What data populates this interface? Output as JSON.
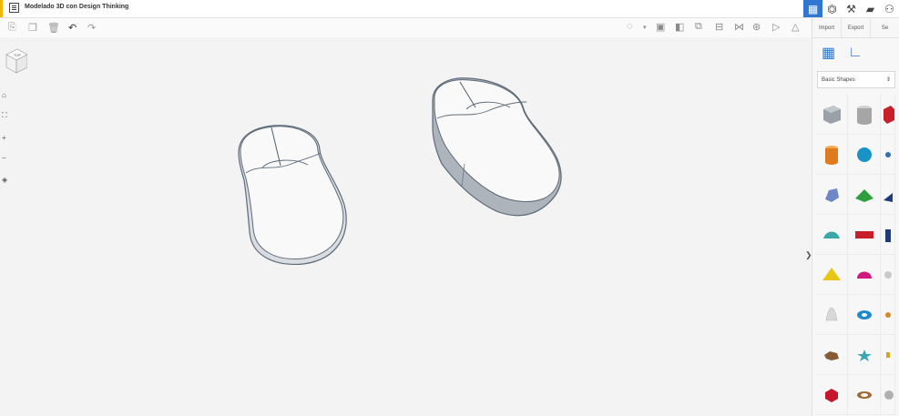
{
  "app": {
    "title": "Modelado 3D con Design Thinking"
  },
  "topbar": {
    "icons": [
      "grid-view-icon",
      "simulate-icon",
      "tools-icon",
      "bricks-icon",
      "user-icon"
    ]
  },
  "toolbar": {
    "left_icons": [
      "paste-icon",
      "duplicate-icon",
      "delete-icon",
      "undo-icon",
      "redo-icon"
    ],
    "right_icons": [
      "light-icon",
      "dropdown-icon",
      "solid-icon",
      "hole-icon",
      "group-icon",
      "align-icon",
      "mirror-icon",
      "ungroup-icon",
      "workplane-icon",
      "ruler-icon"
    ]
  },
  "viewcube": {
    "label": "TOP"
  },
  "panel": {
    "tabs": [
      "Import",
      "Export",
      "Se"
    ],
    "category": "Basic Shapes",
    "shapes": [
      {
        "name": "box-striped",
        "color": "#9aa0a8"
      },
      {
        "name": "cylinder-striped",
        "color": "#a6a6a6"
      },
      {
        "name": "box-red",
        "color": "#c8202a"
      },
      {
        "name": "cylinder-orange",
        "color": "#e07a1f"
      },
      {
        "name": "sphere-blue",
        "color": "#1793c5"
      },
      {
        "name": "scribble",
        "color": "#2f6fb5"
      },
      {
        "name": "scribble-blue",
        "color": "#6f86c9"
      },
      {
        "name": "roof-green",
        "color": "#2f9e3f"
      },
      {
        "name": "wedge-navy",
        "color": "#1e3b7a"
      },
      {
        "name": "round-roof-teal",
        "color": "#3aa7a8"
      },
      {
        "name": "text-red",
        "color": "#c81f2a"
      },
      {
        "name": "wedge-dark",
        "color": "#1e3b7a"
      },
      {
        "name": "pyramid-yellow",
        "color": "#e9c515"
      },
      {
        "name": "half-sphere-magenta",
        "color": "#d1187e"
      },
      {
        "name": "paraboloid-gray",
        "color": "#c9c9c9"
      },
      {
        "name": "cone-white",
        "color": "#d8d8d8"
      },
      {
        "name": "torus-blue",
        "color": "#1f8cc8"
      },
      {
        "name": "tube-orange",
        "color": "#d9891f"
      },
      {
        "name": "rock-brown",
        "color": "#8a5a34"
      },
      {
        "name": "star-teal",
        "color": "#3aa7b5"
      },
      {
        "name": "ring-gold",
        "color": "#d9a21f"
      },
      {
        "name": "polygon-red",
        "color": "#c9152b"
      },
      {
        "name": "ring-brown",
        "color": "#a06a37"
      },
      {
        "name": "shape-gray",
        "color": "#b0b0b0"
      }
    ]
  }
}
